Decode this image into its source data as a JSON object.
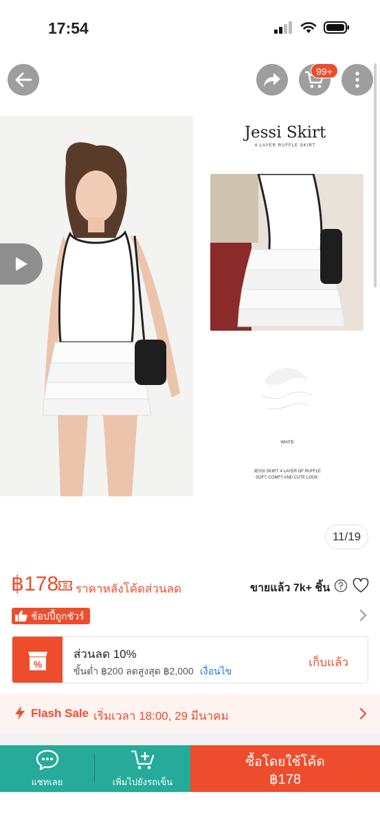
{
  "status_bar": {
    "time": "17:54"
  },
  "header": {
    "cart_badge": "99+"
  },
  "gallery": {
    "brand_title": "Jessi Skirt",
    "brand_subtitle": "4 LAYER RUFFLE SKIRT",
    "swatch_label": "WHITE",
    "description_line1": "JESSI SKIRT: 4 LAYER OF RUFFLE",
    "description_line2": "SOFT, COMFY AND CUTE LOOK.",
    "page_counter": "11/19"
  },
  "product": {
    "price": "฿178",
    "price_note": "ราคาหลังโค้ดส่วนลด",
    "sold": "ขายแล้ว 7k+ ชิ้น",
    "mall_badge": "ช้อปปี้ถูกชัวร์"
  },
  "voucher": {
    "title": "ส่วนลด 10%",
    "condition": "ขั้นต่ำ ฿200 ลดสูงสุด ฿2,000",
    "terms_link": "เงื่อนไข",
    "status": "เก็บแล้ว"
  },
  "flash_sale": {
    "label": "Flash Sale",
    "start_time": "เริ่มเวลา 18:00, 29 มีนาคม"
  },
  "bottom_bar": {
    "chat_label": "แชทเลย",
    "add_to_cart_label": "เพิ่มไปยังรถเข็น",
    "buy_label": "ซื้อโดยใช้โค้ด",
    "buy_price": "฿178"
  },
  "colors": {
    "accent": "#ee4d2d",
    "chat_green": "#26aa99",
    "link_blue": "#2673dd"
  }
}
